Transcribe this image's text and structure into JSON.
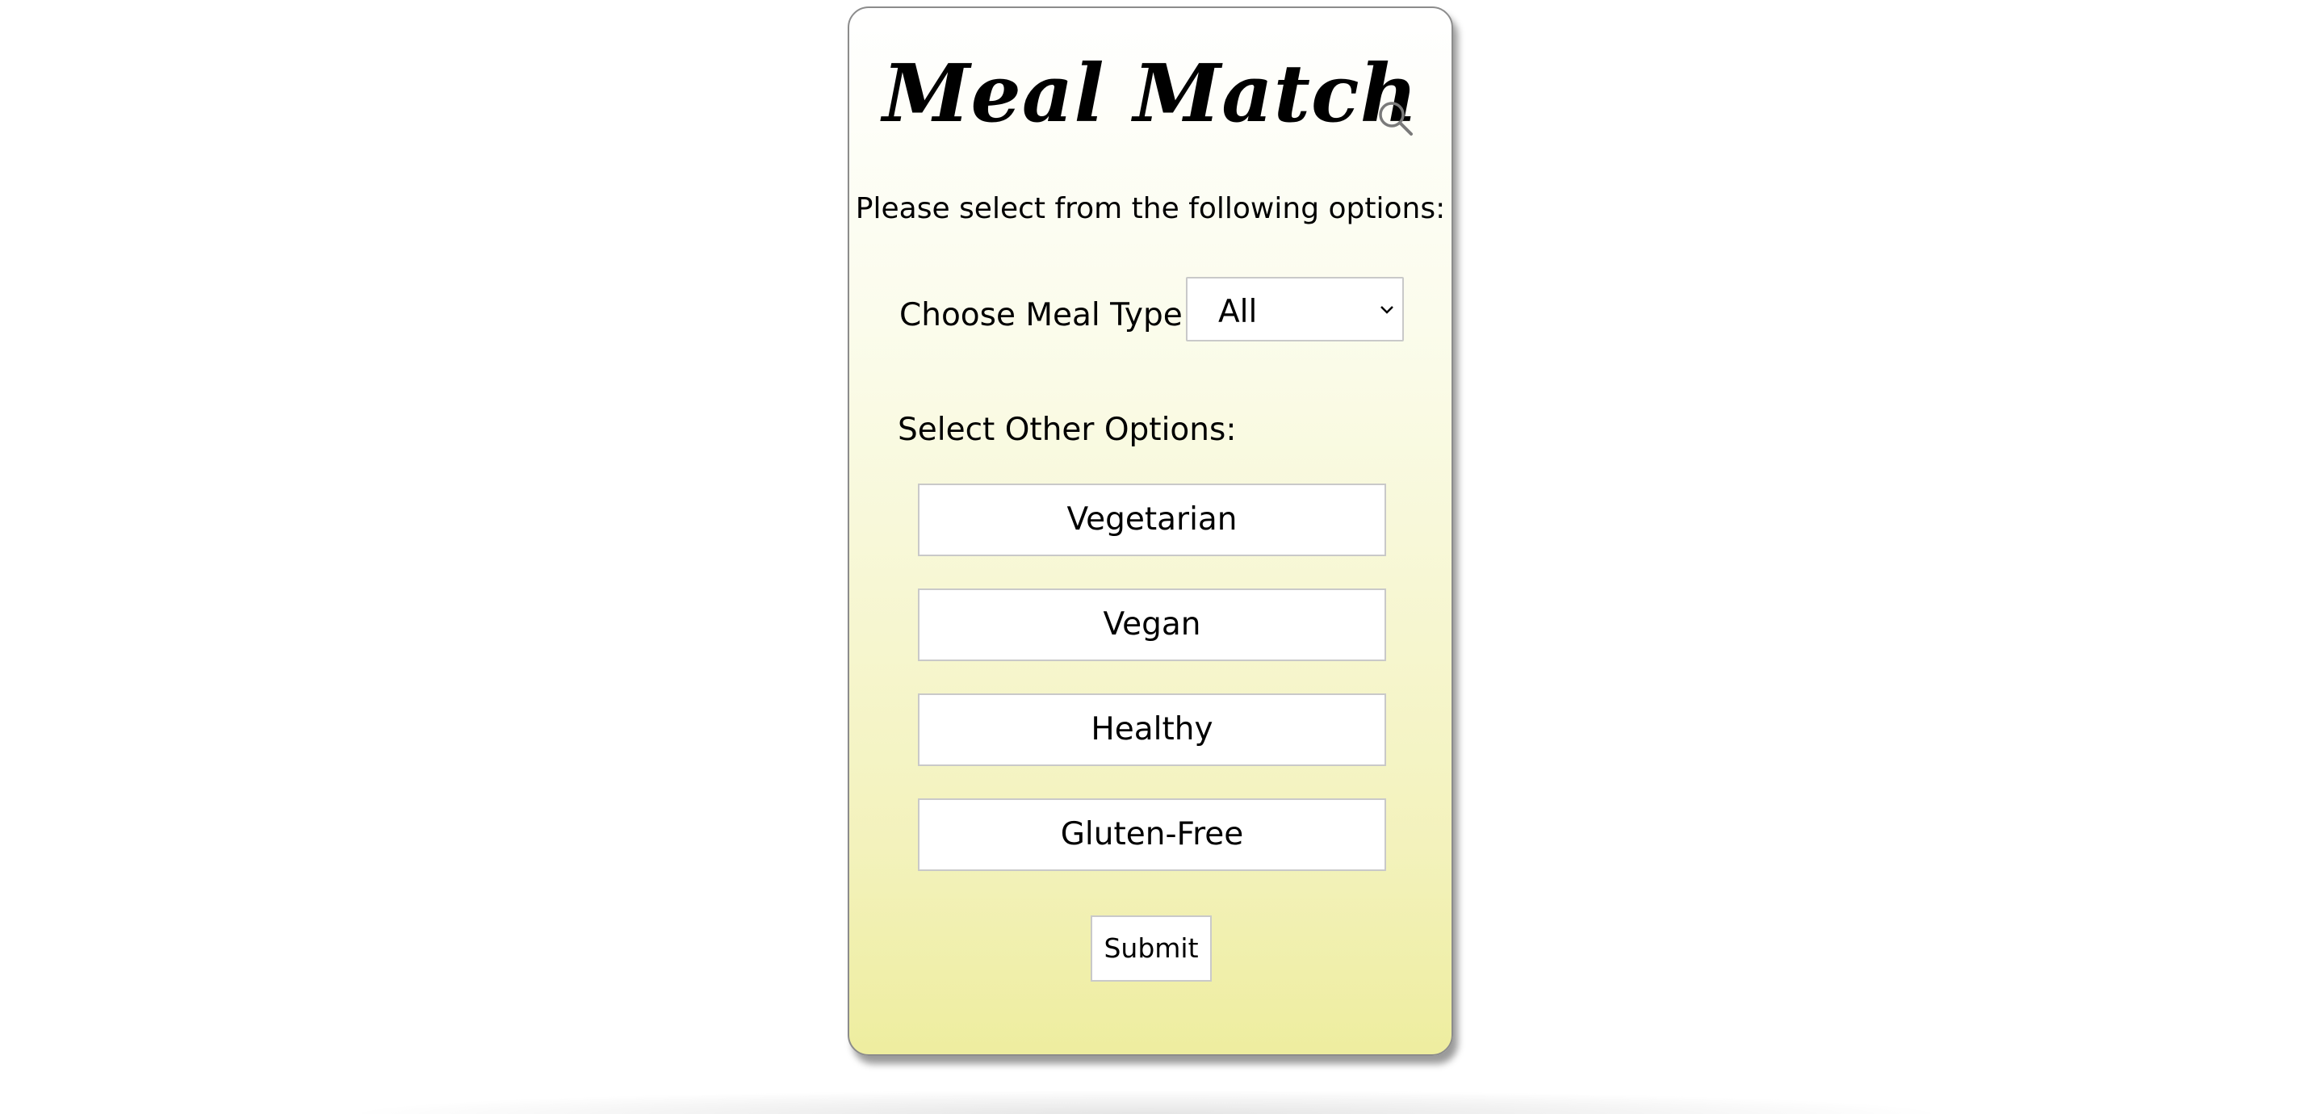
{
  "app": {
    "title": "Meal Match"
  },
  "header": {
    "search_icon": "search-icon"
  },
  "form": {
    "instructions": "Please select from the following options:",
    "meal_type_label": "Choose Meal Type:",
    "meal_type_selected": "All",
    "other_options_label": "Select Other Options:",
    "options": [
      {
        "label": "Vegetarian"
      },
      {
        "label": "Vegan"
      },
      {
        "label": "Healthy"
      },
      {
        "label": "Gluten-Free"
      }
    ],
    "submit_label": "Submit"
  },
  "colors": {
    "card_gradient_top": "#ffffff",
    "card_gradient_bottom": "#eeed9f",
    "border": "#8c8c8c",
    "input_border": "#c9c9c9"
  }
}
